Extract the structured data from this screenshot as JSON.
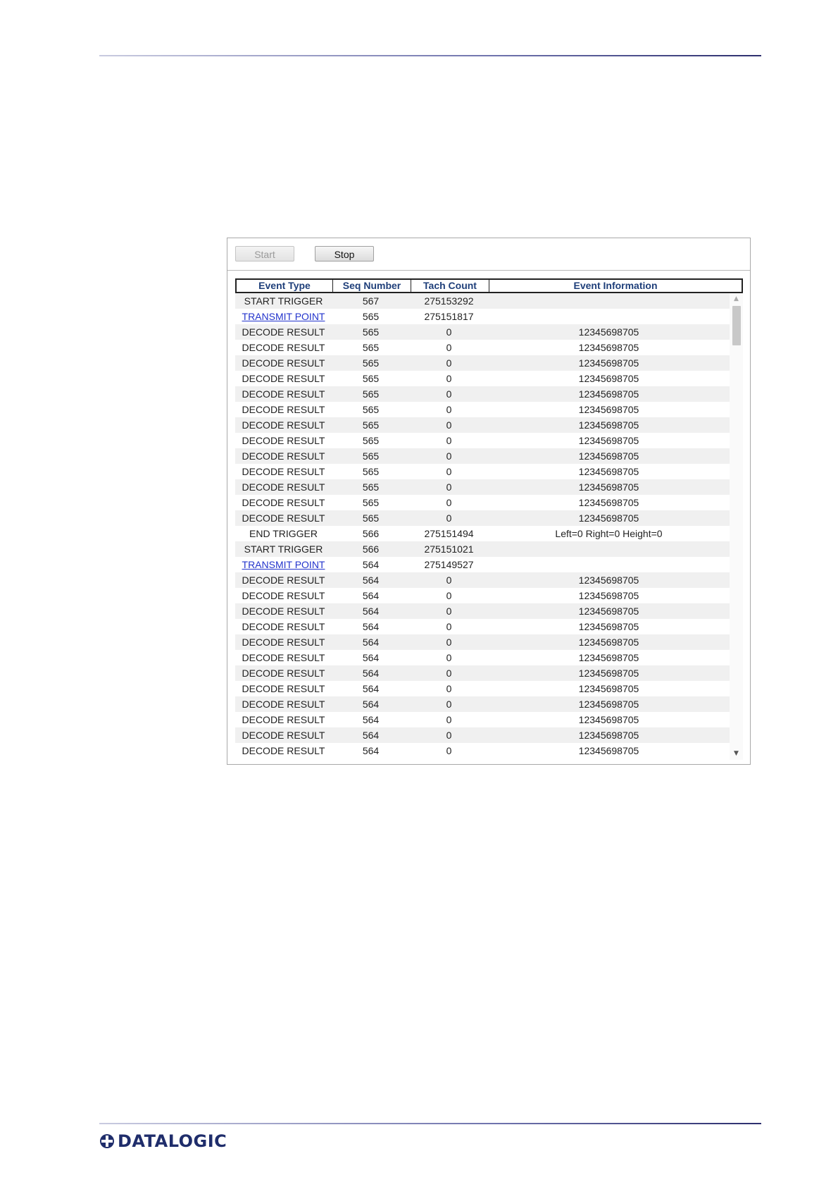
{
  "toolbar": {
    "start_label": "Start",
    "stop_label": "Stop"
  },
  "table": {
    "headers": [
      "Event Type",
      "Seq Number",
      "Tach Count",
      "Event Information"
    ],
    "rows": [
      [
        "START TRIGGER",
        "567",
        "275153292",
        ""
      ],
      [
        "TRANSMIT POINT",
        "565",
        "275151817",
        ""
      ],
      [
        "DECODE RESULT",
        "565",
        "0",
        "12345698705"
      ],
      [
        "DECODE RESULT",
        "565",
        "0",
        "12345698705"
      ],
      [
        "DECODE RESULT",
        "565",
        "0",
        "12345698705"
      ],
      [
        "DECODE RESULT",
        "565",
        "0",
        "12345698705"
      ],
      [
        "DECODE RESULT",
        "565",
        "0",
        "12345698705"
      ],
      [
        "DECODE RESULT",
        "565",
        "0",
        "12345698705"
      ],
      [
        "DECODE RESULT",
        "565",
        "0",
        "12345698705"
      ],
      [
        "DECODE RESULT",
        "565",
        "0",
        "12345698705"
      ],
      [
        "DECODE RESULT",
        "565",
        "0",
        "12345698705"
      ],
      [
        "DECODE RESULT",
        "565",
        "0",
        "12345698705"
      ],
      [
        "DECODE RESULT",
        "565",
        "0",
        "12345698705"
      ],
      [
        "DECODE RESULT",
        "565",
        "0",
        "12345698705"
      ],
      [
        "DECODE RESULT",
        "565",
        "0",
        "12345698705"
      ],
      [
        "END TRIGGER",
        "566",
        "275151494",
        "Left=0 Right=0 Height=0"
      ],
      [
        "START TRIGGER",
        "566",
        "275151021",
        ""
      ],
      [
        "TRANSMIT POINT",
        "564",
        "275149527",
        ""
      ],
      [
        "DECODE RESULT",
        "564",
        "0",
        "12345698705"
      ],
      [
        "DECODE RESULT",
        "564",
        "0",
        "12345698705"
      ],
      [
        "DECODE RESULT",
        "564",
        "0",
        "12345698705"
      ],
      [
        "DECODE RESULT",
        "564",
        "0",
        "12345698705"
      ],
      [
        "DECODE RESULT",
        "564",
        "0",
        "12345698705"
      ],
      [
        "DECODE RESULT",
        "564",
        "0",
        "12345698705"
      ],
      [
        "DECODE RESULT",
        "564",
        "0",
        "12345698705"
      ],
      [
        "DECODE RESULT",
        "564",
        "0",
        "12345698705"
      ],
      [
        "DECODE RESULT",
        "564",
        "0",
        "12345698705"
      ],
      [
        "DECODE RESULT",
        "564",
        "0",
        "12345698705"
      ],
      [
        "DECODE RESULT",
        "564",
        "0",
        "12345698705"
      ],
      [
        "DECODE RESULT",
        "564",
        "0",
        "12345698705"
      ]
    ],
    "link_event_types": [
      "TRANSMIT POINT"
    ]
  },
  "footer": {
    "logo_text": "DATALOGIC"
  },
  "colors": {
    "header_text": "#1f3f7a",
    "link": "#2233cc",
    "rule": "#2d2f6e",
    "logo": "#1f2d6b"
  },
  "icons": {
    "logo": "datalogic-logo-icon",
    "scroll_up": "scroll-up-arrow-icon",
    "scroll_down": "scroll-down-arrow-icon"
  }
}
